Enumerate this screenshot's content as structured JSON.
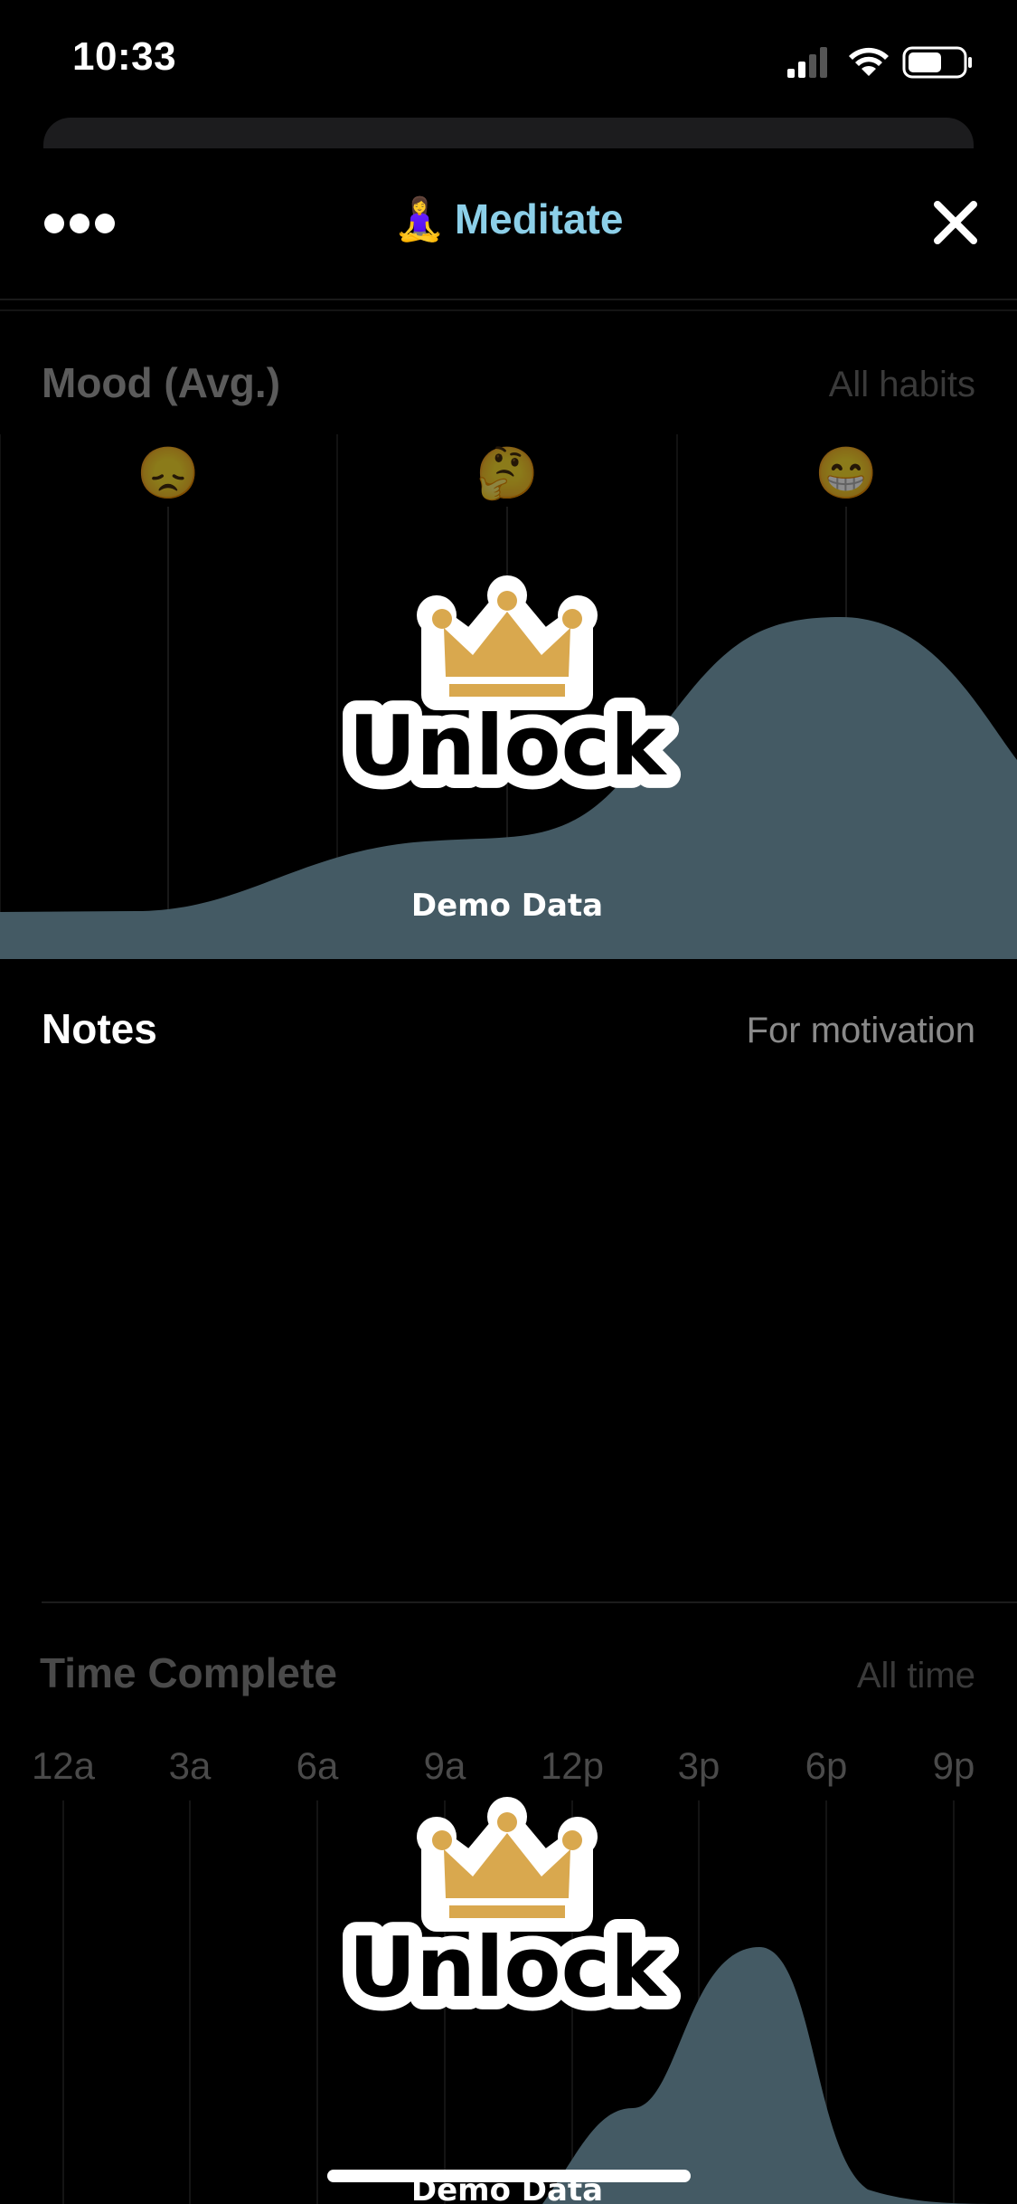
{
  "status_bar": {
    "time": "10:33"
  },
  "nav": {
    "title": "Meditate",
    "title_emoji": "🧘‍♀️"
  },
  "mood": {
    "title": "Mood (Avg.)",
    "subtitle": "All habits",
    "emojis": [
      "😞",
      "🤔",
      "😁"
    ],
    "unlock_label": "Unlock",
    "demo_label": "Demo Data"
  },
  "notes": {
    "title": "Notes",
    "subtitle": "For motivation"
  },
  "time_complete": {
    "title": "Time Complete",
    "subtitle": "All time",
    "unlock_label": "Unlock",
    "demo_label": "Demo Data"
  },
  "chart_data": [
    {
      "type": "area",
      "title": "Mood (Avg.)",
      "categories": [
        "😞",
        "🤔",
        "😁"
      ],
      "values": [
        0.05,
        0.28,
        0.75
      ]
    },
    {
      "type": "area",
      "title": "Time Complete",
      "categories": [
        "12a",
        "3a",
        "6a",
        "9a",
        "12p",
        "3p",
        "6p",
        "9p"
      ],
      "values": [
        0,
        0,
        0,
        0,
        0,
        0.35,
        0.75,
        0.02
      ]
    }
  ],
  "colors": {
    "accent_title": "#8ccfe8",
    "chart_fill": "#445a64",
    "crown": "#d9a84e"
  }
}
